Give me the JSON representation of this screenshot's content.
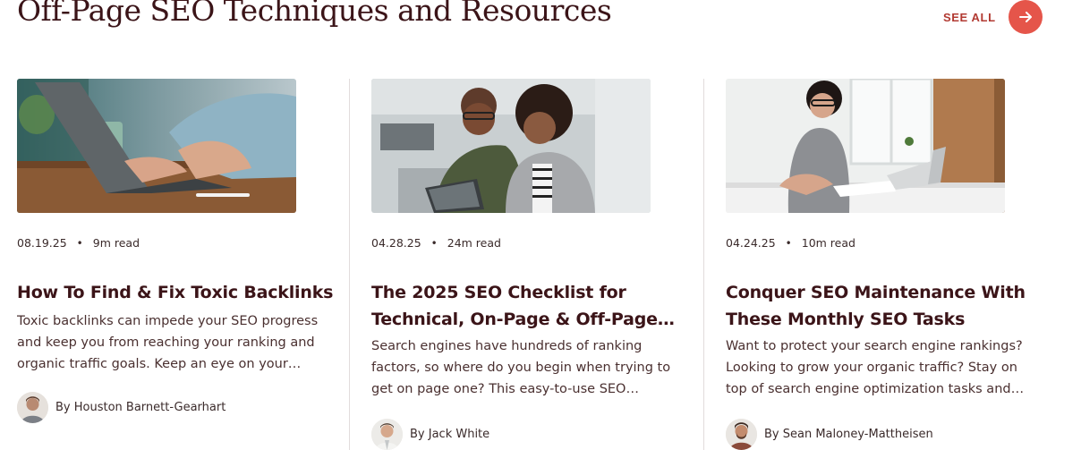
{
  "section": {
    "title": "Off-Page SEO Techniques and Resources",
    "see_all_label": "SEE ALL",
    "arrow_icon": "arrow-right-icon"
  },
  "colors": {
    "title": "#3b1418",
    "accent": "#e5554a",
    "accent_text": "#b23a32"
  },
  "cards": [
    {
      "image": "laptop-typing-photo",
      "date": "08.19.25",
      "read_time": "9m read",
      "title": "How To Find & Fix Toxic Backlinks",
      "description": "Toxic backlinks can impede your SEO progress and keep you from reaching your ranking and organic traffic goals. Keep an eye on your…",
      "author": "By Houston Barnett-Gearhart"
    },
    {
      "image": "coworkers-tablet-photo",
      "date": "04.28.25",
      "read_time": "24m read",
      "title": "The 2025 SEO Checklist for Technical, On-Page & Off-Page…",
      "description": "Search engines have hundreds of ranking factors, so where do you begin when trying to get on page one? This easy-to-use SEO…",
      "author": "By Jack White"
    },
    {
      "image": "woman-writing-photo",
      "date": "04.24.25",
      "read_time": "10m read",
      "title": "Conquer SEO Maintenance With These Monthly SEO Tasks",
      "description": "Want to protect your search engine rankings? Looking to grow your organic traffic? Stay on top of search engine optimization tasks and…",
      "author": "By Sean Maloney-Mattheisen"
    }
  ]
}
